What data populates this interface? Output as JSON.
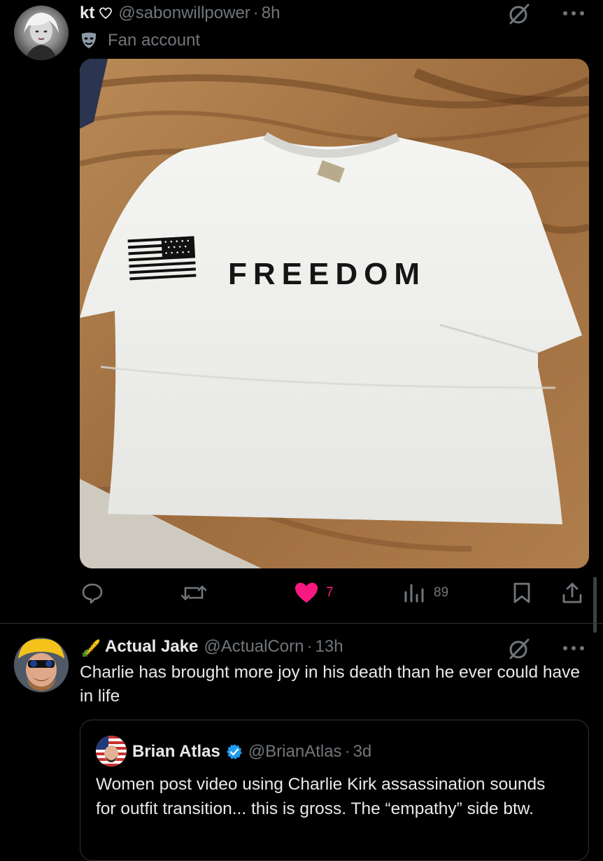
{
  "post1": {
    "display_name": "kt",
    "handle": "@sabonwillpower",
    "time": "8h",
    "subtitle": "Fan account",
    "image_text": "FREEDOM",
    "stats": {
      "replies": "",
      "reposts": "",
      "likes": "7",
      "views": "89"
    },
    "like_color": "#f91880"
  },
  "post2": {
    "display_name": "Actual Jake",
    "handle": "@ActualCorn",
    "time": "13h",
    "text": "Charlie has brought more joy in his death than he ever could have in life",
    "quote": {
      "display_name": "Brian Atlas",
      "handle": "@BrianAtlas",
      "time": "3d",
      "text": "Women post video using Charlie Kirk assassination sounds for outfit transition... this is gross. The “empathy” side btw."
    },
    "verified_color": "#1d9bf0"
  },
  "separator": "·",
  "icons": [
    "grok-icon",
    "more-icon",
    "reply-icon",
    "repost-icon",
    "heart-icon",
    "views-icon",
    "bookmark-icon",
    "share-icon",
    "verified-badge-icon",
    "corn-emoji-icon",
    "theater-mask-icon"
  ]
}
